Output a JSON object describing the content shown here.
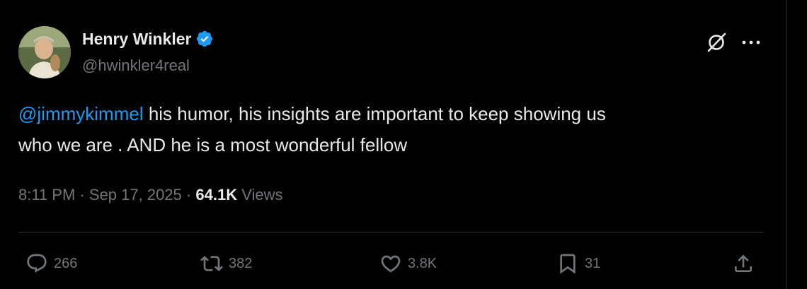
{
  "tweet": {
    "author": {
      "name": "Henry Winkler",
      "handle": "@hwinkler4real",
      "verified": true
    },
    "mention": "@jimmykimmel",
    "text_line1_rest": " his humor, his insights are important to keep showing us",
    "text_line2": "who we are . AND he is a most wonderful fellow",
    "time": "8:11 PM",
    "date": "Sep 17, 2025",
    "separator": "·",
    "views_count": "64.1K",
    "views_label": "Views"
  },
  "actions": {
    "reply_count": "266",
    "repost_count": "382",
    "like_count": "3.8K",
    "bookmark_count": "31"
  },
  "colors": {
    "background": "#000000",
    "text": "#e7e9ea",
    "secondary": "#71767b",
    "accent": "#1d9bf0",
    "divider": "#2f3336"
  },
  "icons": {
    "verified": "verified-badge-icon",
    "grok": "grok-icon",
    "more": "more-icon",
    "reply": "reply-icon",
    "repost": "repost-icon",
    "like": "like-icon",
    "bookmark": "bookmark-icon",
    "share": "share-icon"
  }
}
